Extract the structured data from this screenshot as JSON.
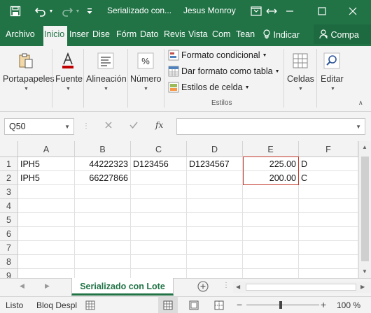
{
  "titlebar": {
    "filename": "Serializado con...",
    "user": "Jesus Monroy",
    "bg_color": "#217346"
  },
  "ribbon_tabs": {
    "items": [
      "Archivo",
      "Inicio",
      "Inser",
      "Dise",
      "Fórm",
      "Dato",
      "Revis",
      "Vista",
      "Com",
      "Tean"
    ],
    "active": "Inicio",
    "tell_me": "Indicar",
    "share": "Compa"
  },
  "ribbon": {
    "groups": {
      "portapapeles": "Portapapeles",
      "fuente": "Fuente",
      "alineacion": "Alineación",
      "numero": "Número",
      "celdas": "Celdas",
      "editar": "Editar"
    },
    "styles": {
      "conditional": "Formato condicional",
      "as_table": "Dar formato como tabla",
      "cell_styles": "Estilos de celda",
      "group_label": "Estilos"
    }
  },
  "formula_bar": {
    "name_box": "Q50",
    "fx": "fx",
    "value": ""
  },
  "grid": {
    "columns": [
      "A",
      "B",
      "C",
      "D",
      "E",
      "F"
    ],
    "rows": [
      "1",
      "2",
      "3",
      "4",
      "5",
      "6",
      "7",
      "8",
      "9"
    ],
    "cells": [
      [
        "IPH5",
        "44222323",
        "D123456",
        "D1234567",
        "225.00",
        "D"
      ],
      [
        "IPH5",
        "66227866",
        "",
        "",
        "200.00",
        "C"
      ]
    ],
    "highlight_color": "#c0392b"
  },
  "sheets": {
    "active": "Serializado con Lote"
  },
  "statusbar": {
    "ready": "Listo",
    "scroll_lock": "Bloq Despl",
    "zoom": "100 %"
  }
}
